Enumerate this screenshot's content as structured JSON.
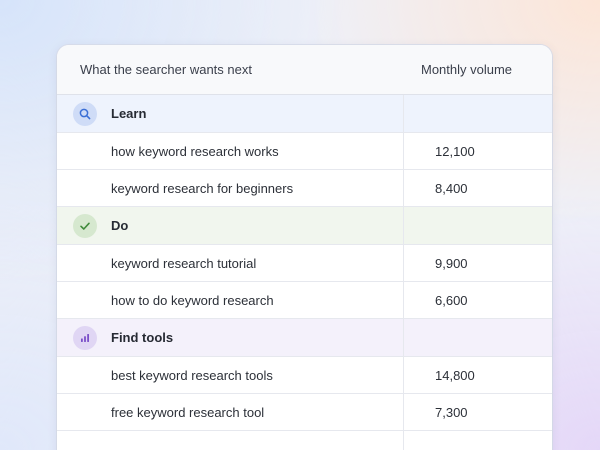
{
  "table": {
    "columns": [
      "What the searcher wants next",
      "Monthly volume"
    ],
    "groups": [
      {
        "label": "Learn",
        "icon": "search-icon",
        "color": "#3b6fd6",
        "rows": [
          {
            "keyword": "how keyword research works",
            "volume": "12,100"
          },
          {
            "keyword": "keyword research for beginners",
            "volume": "8,400"
          }
        ]
      },
      {
        "label": "Do",
        "icon": "check-icon",
        "color": "#3f8a3a",
        "rows": [
          {
            "keyword": "keyword research tutorial",
            "volume": "9,900"
          },
          {
            "keyword": "how to do keyword research",
            "volume": "6,600"
          }
        ]
      },
      {
        "label": "Find tools",
        "icon": "bar-chart-icon",
        "color": "#7b4fc9",
        "rows": [
          {
            "keyword": "best keyword research tools",
            "volume": "14,800"
          },
          {
            "keyword": "free keyword research tool",
            "volume": "7,300"
          }
        ]
      }
    ]
  }
}
